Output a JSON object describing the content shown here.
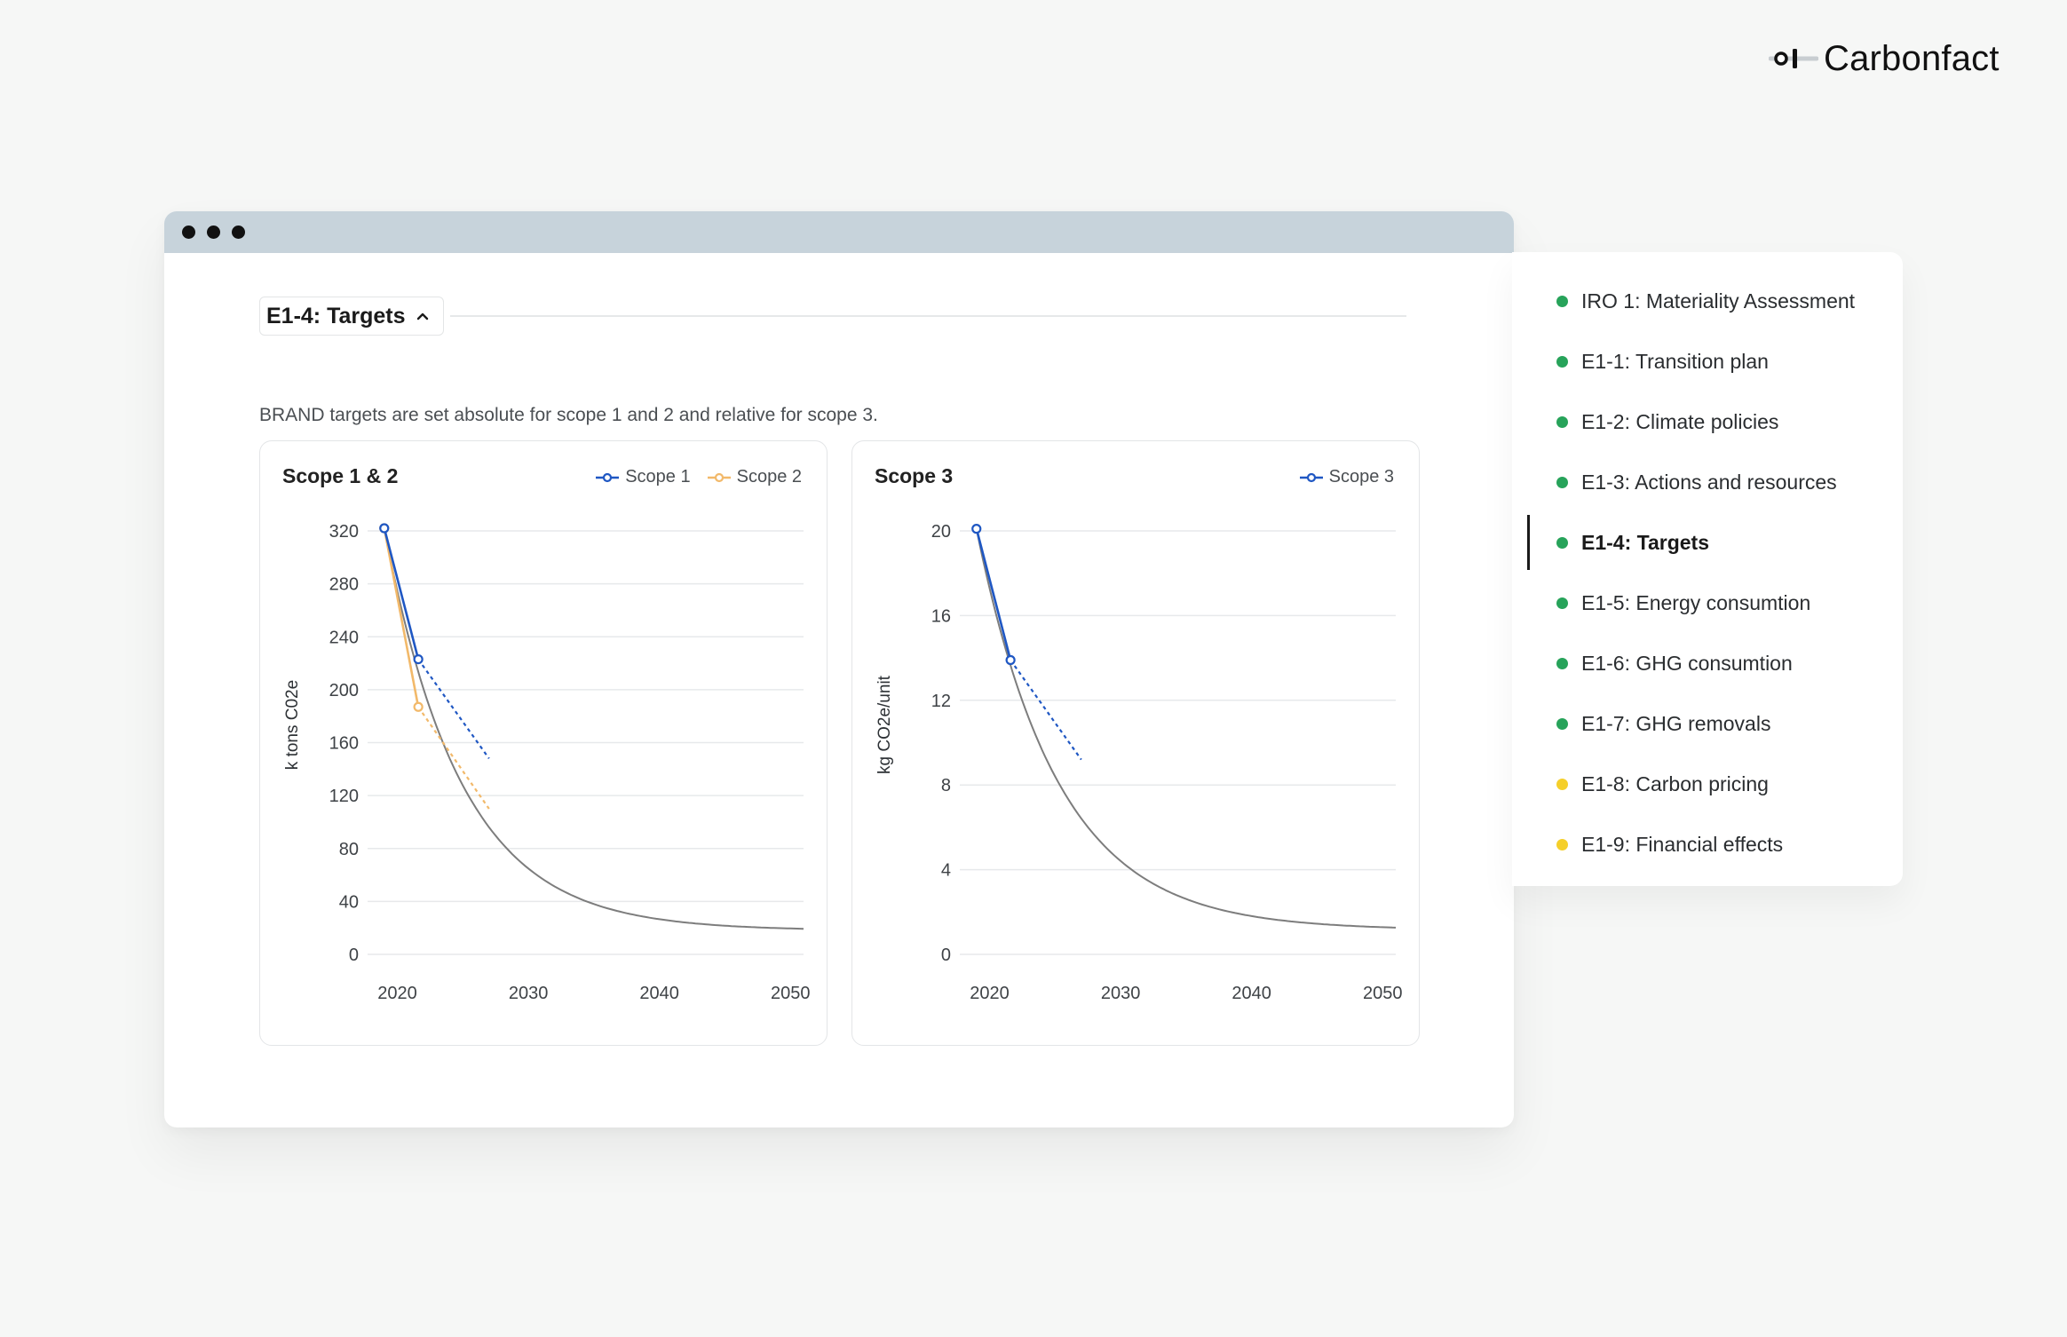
{
  "brand": {
    "name": "Carbonfact"
  },
  "section": {
    "title": "E1-4: Targets"
  },
  "description": "BRAND targets are set absolute for scope 1 and 2 and relative for scope 3.",
  "colors": {
    "scope1": "#1f57c3",
    "scope2": "#f2b96a",
    "trajectory": "#7d7d7d",
    "green": "#27a35a",
    "yellow": "#f5cf2a"
  },
  "cards": [
    {
      "title": "Scope 1 & 2",
      "ylabel": "k tons C02e",
      "legend": [
        "Scope 1",
        "Scope 2"
      ]
    },
    {
      "title": "Scope 3",
      "ylabel": "kg CO2e/unit",
      "legend": [
        "Scope 3"
      ]
    }
  ],
  "chart_data": [
    {
      "type": "line",
      "title": "Scope 1 & 2",
      "ylabel": "k tons C02e",
      "xlim": [
        2018,
        2051
      ],
      "ylim": [
        0,
        320
      ],
      "xticks": [
        2020,
        2030,
        2040,
        2050
      ],
      "yticks": [
        0,
        40,
        80,
        120,
        160,
        200,
        240,
        280,
        320
      ],
      "grid": true,
      "legend_position": "top-right",
      "series": [
        {
          "name": "Scope 1",
          "color": "#1f57c3",
          "actual": [
            [
              2019,
              322
            ],
            [
              2021.6,
              223
            ]
          ],
          "projection": [
            [
              2021.6,
              223
            ],
            [
              2027,
              148
            ]
          ]
        },
        {
          "name": "Scope 2",
          "color": "#f2b96a",
          "actual": [
            [
              2019,
              322
            ],
            [
              2021.6,
              187
            ]
          ],
          "projection": [
            [
              2021.6,
              187
            ],
            [
              2027,
              110
            ]
          ]
        }
      ],
      "trajectory": {
        "start": [
          2019,
          322
        ],
        "floor": 18,
        "rate": 0.17,
        "end": 2051
      }
    },
    {
      "type": "line",
      "title": "Scope 3",
      "ylabel": "kg CO2e/unit",
      "xlim": [
        2018,
        2051
      ],
      "ylim": [
        0,
        20
      ],
      "xticks": [
        2020,
        2030,
        2040,
        2050
      ],
      "yticks": [
        0,
        4,
        8,
        12,
        16,
        20
      ],
      "grid": true,
      "legend_position": "top-right",
      "series": [
        {
          "name": "Scope 3",
          "color": "#1f57c3",
          "actual": [
            [
              2019,
              20.1
            ],
            [
              2021.6,
              13.9
            ]
          ],
          "projection": [
            [
              2021.6,
              13.9
            ],
            [
              2027,
              9.2
            ]
          ]
        }
      ],
      "trajectory": {
        "start": [
          2019,
          20.1
        ],
        "floor": 1.15,
        "rate": 0.16,
        "end": 2051
      }
    }
  ],
  "sidebar": {
    "items": [
      {
        "label": "IRO 1: Materiality Assessment",
        "status": "green",
        "active": false
      },
      {
        "label": "E1-1: Transition plan",
        "status": "green",
        "active": false
      },
      {
        "label": "E1-2: Climate policies",
        "status": "green",
        "active": false
      },
      {
        "label": "E1-3: Actions and resources",
        "status": "green",
        "active": false
      },
      {
        "label": "E1-4: Targets",
        "status": "green",
        "active": true
      },
      {
        "label": "E1-5: Energy consumtion",
        "status": "green",
        "active": false
      },
      {
        "label": "E1-6: GHG consumtion",
        "status": "green",
        "active": false
      },
      {
        "label": "E1-7: GHG removals",
        "status": "green",
        "active": false
      },
      {
        "label": "E1-8: Carbon pricing",
        "status": "yellow",
        "active": false
      },
      {
        "label": "E1-9: Financial effects",
        "status": "yellow",
        "active": false
      }
    ]
  }
}
